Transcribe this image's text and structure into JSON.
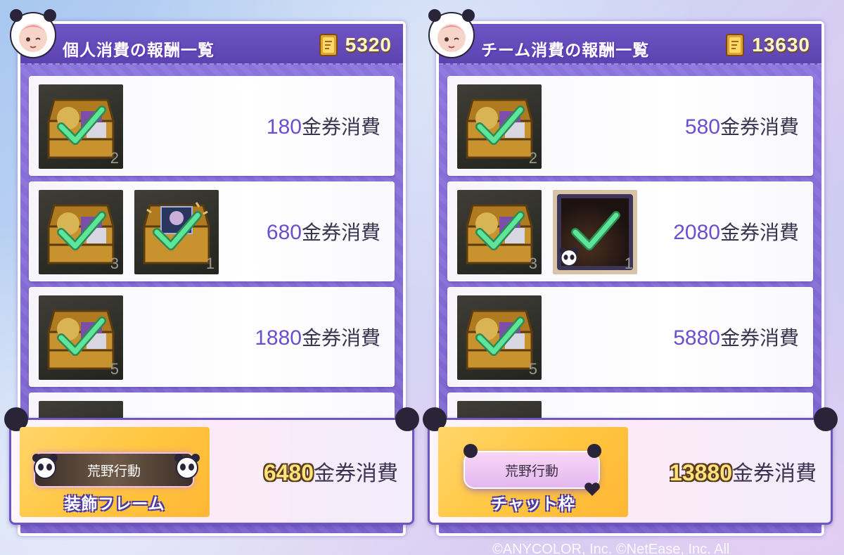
{
  "personal": {
    "title": "個人消費の報酬一覧",
    "balance": "5320",
    "rows": [
      {
        "cost_num": "180",
        "cost_unit": "金券消費",
        "items": [
          {
            "type": "chest",
            "qty": "2"
          }
        ]
      },
      {
        "cost_num": "680",
        "cost_unit": "金券消費",
        "items": [
          {
            "type": "chest",
            "qty": "3"
          },
          {
            "type": "chest-portrait",
            "qty": "1"
          }
        ]
      },
      {
        "cost_num": "1880",
        "cost_unit": "金券消費",
        "items": [
          {
            "type": "chest",
            "qty": "5"
          }
        ]
      }
    ],
    "final": {
      "plate_text": "荒野行動",
      "item_name": "装飾フレーム",
      "cost_num": "6480",
      "cost_unit": "金券消費"
    }
  },
  "team": {
    "title": "チーム消費の報酬一覧",
    "balance": "13630",
    "rows": [
      {
        "cost_num": "580",
        "cost_unit": "金券消費",
        "items": [
          {
            "type": "chest",
            "qty": "2"
          }
        ]
      },
      {
        "cost_num": "2080",
        "cost_unit": "金券消費",
        "items": [
          {
            "type": "chest",
            "qty": "3"
          },
          {
            "type": "avatar-frame",
            "qty": "1"
          }
        ]
      },
      {
        "cost_num": "5880",
        "cost_unit": "金券消費",
        "items": [
          {
            "type": "chest",
            "qty": "5"
          }
        ]
      }
    ],
    "final": {
      "plate_text": "荒野行動",
      "item_name": "チャット枠",
      "cost_num": "13880",
      "cost_unit": "金券消費"
    }
  },
  "copyright": "©ANYCOLOR, Inc. ©NetEase, Inc. All",
  "icons": {
    "balance": "gold-ticket-icon",
    "claimed": "green-check-icon",
    "reward": "treasure-chest-icon"
  },
  "colors": {
    "panel": "#7f67d0",
    "header": "#5b43b0",
    "cost_number": "#6a4fd0",
    "check": "#37c77a",
    "final_bg": "#ffc640"
  }
}
